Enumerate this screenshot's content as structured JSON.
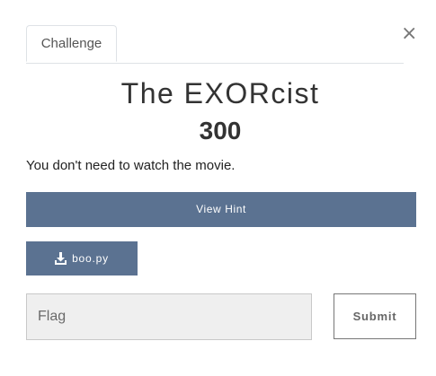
{
  "tabs": [
    {
      "label": "Challenge"
    }
  ],
  "close_symbol": "×",
  "challenge": {
    "name": "The EXORcist",
    "points": "300",
    "description": "You don't need to watch the movie."
  },
  "hint_button": "View Hint",
  "file": {
    "name": "boo.py",
    "icon": "download-icon"
  },
  "flag_input": {
    "value": "",
    "placeholder": "Flag"
  },
  "submit_button": "Submit",
  "colors": {
    "button": "#5b7291",
    "text": "#333333",
    "input_bg": "#efefef"
  }
}
